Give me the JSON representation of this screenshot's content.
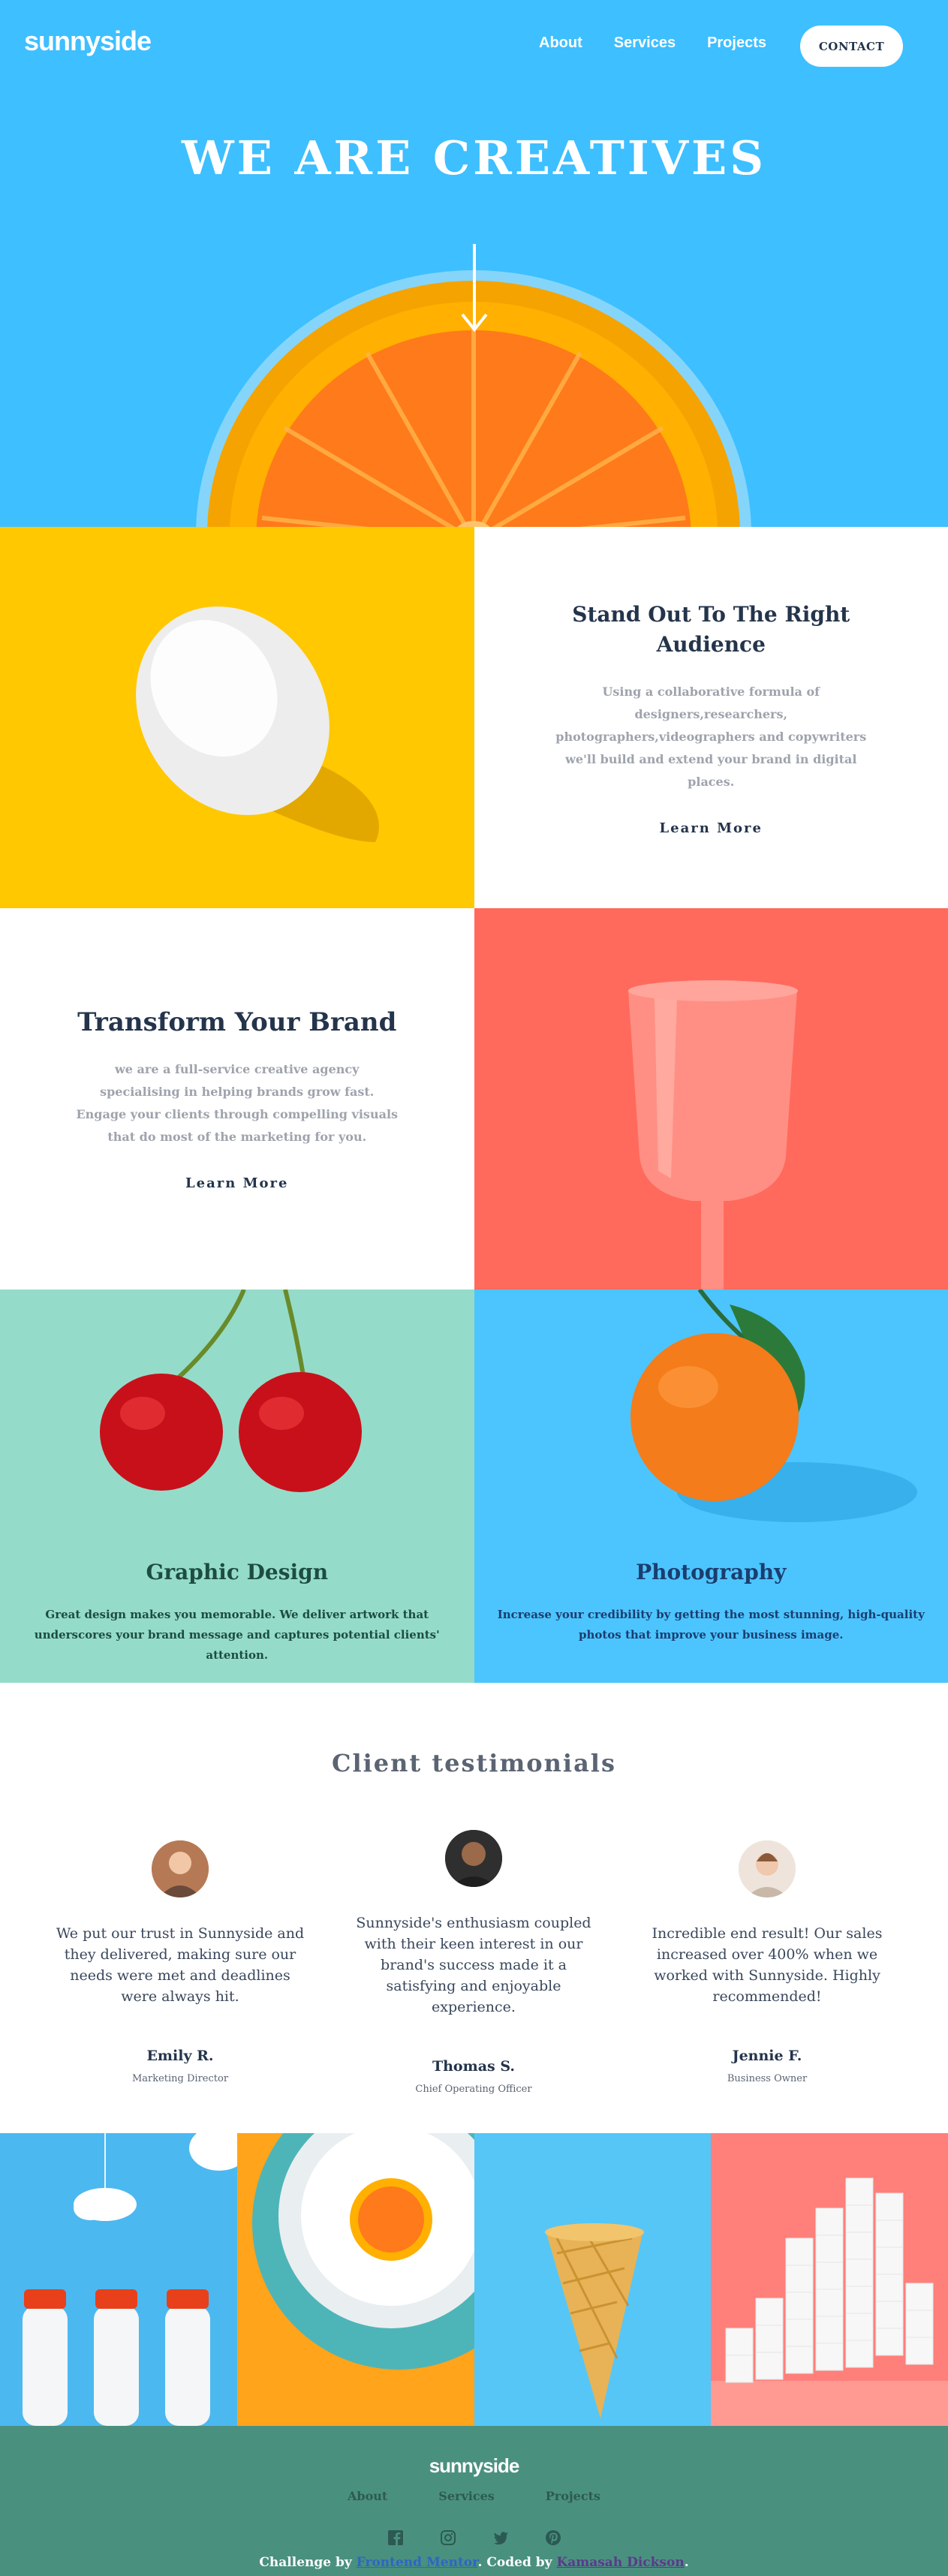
{
  "nav": {
    "logo": "sunnyside",
    "links": [
      "About",
      "Services",
      "Projects"
    ],
    "contact": "CONTACT"
  },
  "hero": {
    "title": "WE ARE CREATIVES"
  },
  "stand_out": {
    "heading_line1": "Stand Out To The Right",
    "heading_line2": "Audience",
    "body": "Using a collaborative formula of designers,researchers, photographers,videographers and copywriters we'll build and extend your brand in digital places.",
    "link": "Learn More"
  },
  "transform": {
    "heading": "Transform Your Brand",
    "body": "we are a full-service creative agency specialising in helping brands grow fast. Engage your clients through compelling visuals that do most of the marketing for you.",
    "link": "Learn More"
  },
  "services": {
    "graphic": {
      "title": "Graphic Design",
      "body": "Great design makes you memorable. We deliver artwork that underscores your brand message and captures potential clients' attention."
    },
    "photo": {
      "title": "Photography",
      "body": "Increase your credibility by getting the most stunning, high-quality photos that improve your business image."
    }
  },
  "testimonials": {
    "title": "Client testimonials",
    "items": [
      {
        "quote": "We put our trust in Sunnyside and they delivered, making sure our needs were met and deadlines were always hit.",
        "name": "Emily R.",
        "role": "Marketing Director"
      },
      {
        "quote": "Sunnyside's enthusiasm coupled with their keen interest in our brand's success made it a satisfying and enjoyable experience.",
        "name": "Thomas S.",
        "role": "Chief Operating Officer"
      },
      {
        "quote": "Incredible end result! Our sales increased over 400% when we worked with Sunnyside. Highly recommended!",
        "name": "Jennie F.",
        "role": "Business Owner"
      }
    ]
  },
  "footer": {
    "logo": "sunnyside",
    "links": [
      "About",
      "Services",
      "Projects"
    ],
    "icons": [
      "facebook-icon",
      "instagram-icon",
      "twitter-icon",
      "pinterest-icon"
    ],
    "attribution_prefix": "Challenge by ",
    "attribution_link1": "Frontend Mentor",
    "attribution_mid": ". Coded by ",
    "attribution_link2": "Kamasah Dickson",
    "attribution_suffix": "."
  },
  "colors": {
    "hero_blue": "#3ebfff",
    "egg_yellow": "#ffc800",
    "cup_coral": "#ff6a5c",
    "cherry_mint": "#94dcc9",
    "footer_green": "#4a907f"
  }
}
